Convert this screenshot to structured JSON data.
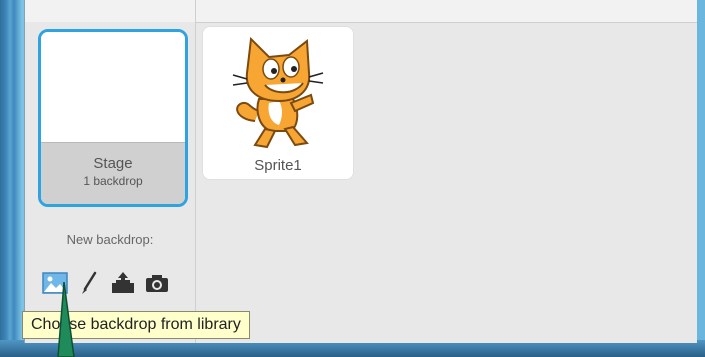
{
  "stage": {
    "name": "Stage",
    "backdrops_text": "1 backdrop"
  },
  "new_backdrop": {
    "label": "New backdrop:",
    "tools": [
      {
        "icon": "image-icon",
        "action": "choose-from-library"
      },
      {
        "icon": "paintbrush-icon",
        "action": "paint"
      },
      {
        "icon": "upload-icon",
        "action": "upload"
      },
      {
        "icon": "camera-icon",
        "action": "camera"
      }
    ]
  },
  "sprites": [
    {
      "name": "Sprite1",
      "icon": "scratch-cat-icon"
    }
  ],
  "tooltip": {
    "text": "Choose backdrop from library"
  },
  "colors": {
    "selection_border": "#2ea3e0",
    "panel_bg": "#e8e8e8",
    "tooltip_bg": "#ffffcc",
    "cat_orange": "#f7a533"
  }
}
